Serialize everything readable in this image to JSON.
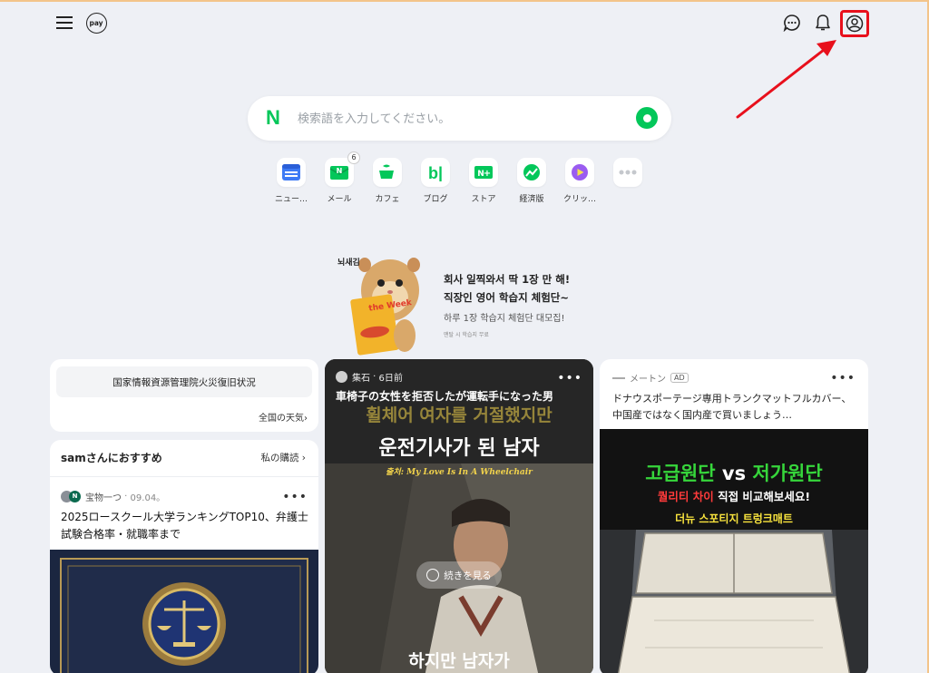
{
  "header": {
    "menu_icon": "hamburger-menu-icon",
    "pay_label": "pay",
    "talk_icon": "chat-bubble-icon",
    "bell_icon": "bell-icon",
    "profile_icon": "user-profile-icon",
    "highlight_color": "#e8101c"
  },
  "search": {
    "logo": "N",
    "placeholder": "検索語を入力してください。",
    "value": "",
    "brand_color": "#03c75a"
  },
  "shortcuts": [
    {
      "label": "ニュー…",
      "icon": "news-icon"
    },
    {
      "label": "メール",
      "icon": "mail-icon",
      "badge": "6"
    },
    {
      "label": "カフェ",
      "icon": "cafe-icon"
    },
    {
      "label": "ブログ",
      "icon": "blog-icon"
    },
    {
      "label": "ストア",
      "icon": "store-icon"
    },
    {
      "label": "経済版",
      "icon": "finance-icon"
    },
    {
      "label": "クリッ…",
      "icon": "clip-play-icon"
    },
    {
      "label": "",
      "icon": "more-dots-icon"
    }
  ],
  "ad_banner": {
    "brand": "뇌새김",
    "book_title": "the Week",
    "line1": "회사 일찍와서 딱 1장 만 해!",
    "line2": "직장인 영어 학습지 체험단~",
    "line3": "하루 1장 학습지 체험단 대모집!",
    "line4": "맨탈 시 학습지 무료"
  },
  "notice": {
    "text": "国家情報資源管理院火災復旧状況",
    "weather_link": "全国の天気"
  },
  "recommend": {
    "title": "samさんにおすすめ",
    "subscribe": "私の購読",
    "source": "宝物一つ",
    "date": "09.04。",
    "headline": "2025ロースクール大学ランキングTOP10、弁護士試験合格率・就職率まで",
    "more": "•••"
  },
  "video_card": {
    "source": "集石",
    "time": "6日前",
    "title": "車椅子の女性を拒否したが運転手になった男",
    "overlay_line1": "휠체어 여자를 거절했지만",
    "overlay_line2": "운전기사가 된 남자",
    "overlay_en": "출처: My Love Is In A Wheelchair",
    "button": "続きを見る",
    "subtitle": "하지만 남자가",
    "more": "•••"
  },
  "ad_card": {
    "source": "メートン",
    "tag": "AD",
    "text": "ドナウスポーテージ専用トランクマットフルカバー、中国産ではなく国内産で買いましょう…",
    "h1_left": "고급원단",
    "h1_vs": "vs",
    "h1_right": "저가원단",
    "h2_red": "퀄리티 차이",
    "h2_rest": "직접 비교해보세요!",
    "h3": "더뉴 스포티지 트렁크매트",
    "more": "•••"
  }
}
